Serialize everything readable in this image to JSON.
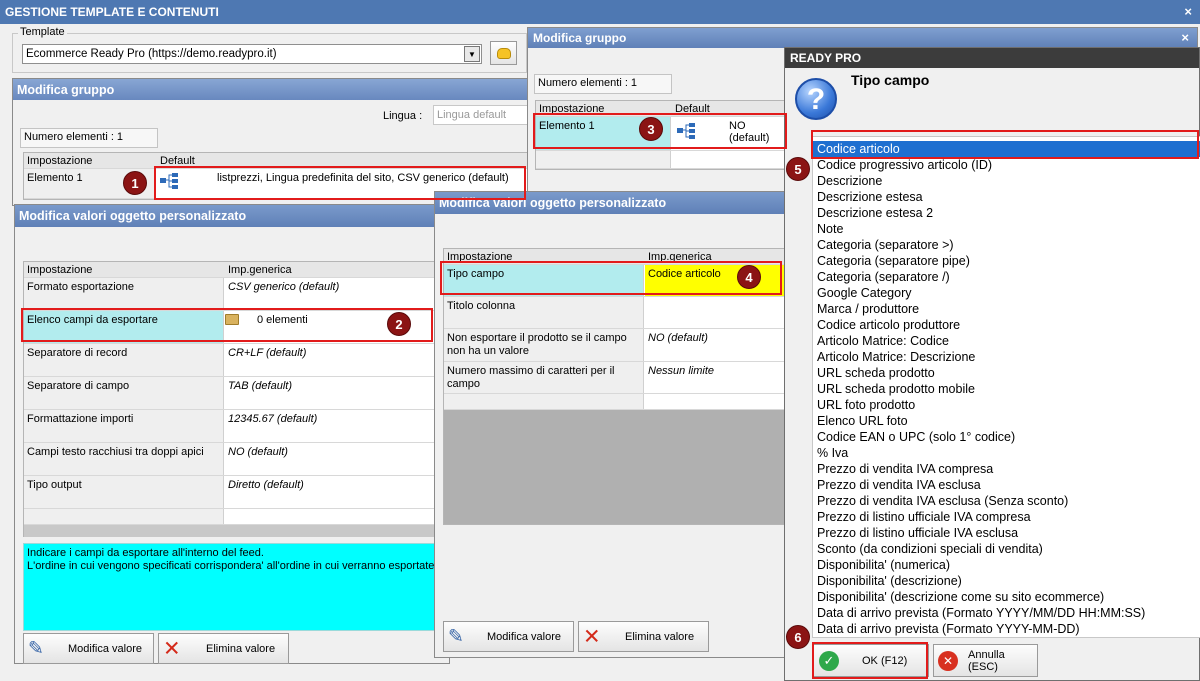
{
  "main": {
    "title": "GESTIONE TEMPLATE E CONTENUTI",
    "close": "×",
    "template_legend": "Template",
    "template_value": "Ecommerce Ready Pro (https://demo.readypro.it)"
  },
  "group1": {
    "title": "Modifica gruppo",
    "lingua_label": "Lingua :",
    "lingua_placeholder": "Lingua default",
    "num_elementi": "Numero elementi : 1",
    "col_impostazione": "Impostazione",
    "col_default": "Default",
    "row_label": "Elemento 1",
    "row_value": "listprezzi, Lingua predefinita del sito, CSV generico (default)"
  },
  "custom1": {
    "title": "Modifica valori oggetto personalizzato",
    "col_impostazione": "Impostazione",
    "col_generica": "Imp.generica",
    "rows": [
      {
        "label": "Formato esportazione",
        "value": "CSV generico (default)"
      },
      {
        "label": "Elenco campi da esportare",
        "value": "0 elementi"
      },
      {
        "label": "Separatore di record",
        "value": "CR+LF (default)"
      },
      {
        "label": "Separatore di campo",
        "value": "TAB (default)"
      },
      {
        "label": "Formattazione importi",
        "value": "12345.67 (default)"
      },
      {
        "label": "Campi testo racchiusi tra doppi apici",
        "value": "NO (default)"
      },
      {
        "label": "Tipo output",
        "value": "Diretto (default)"
      }
    ],
    "help_line1": "Indicare i campi da esportare all'interno del feed.",
    "help_line2": "L'ordine in cui vengono specificati corrispondera' all'ordine in cui verranno esportate le",
    "btn_modifica": "Modifica valore",
    "btn_elimina": "Elimina valore"
  },
  "group2": {
    "title": "Modifica gruppo",
    "close": "×",
    "num_elementi": "Numero elementi : 1",
    "col_impostazione": "Impostazione",
    "col_default": "Default",
    "row_label": "Elemento 1",
    "row_value": "NO (default)"
  },
  "custom2": {
    "title": "Modifica valori oggetto personalizzato",
    "col_impostazione": "Impostazione",
    "col_generica": "Imp.generica",
    "rows": [
      {
        "label": "Tipo campo",
        "value": "Codice articolo"
      },
      {
        "label": "Titolo colonna",
        "value": ""
      },
      {
        "label": "Non esportare il prodotto se il campo non ha un valore",
        "value": "NO (default)"
      },
      {
        "label": "Numero massimo di caratteri per il campo",
        "value": "Nessun limite"
      }
    ],
    "btn_modifica": "Modifica valore",
    "btn_elimina": "Elimina valore"
  },
  "readypro": {
    "title": "READY PRO",
    "heading": "Tipo campo",
    "options": [
      "Codice articolo",
      "Codice progressivo articolo (ID)",
      "Descrizione",
      "Descrizione estesa",
      "Descrizione estesa 2",
      "Note",
      "Categoria (separatore >)",
      "Categoria (separatore pipe)",
      "Categoria (separatore /)",
      "Google Category",
      "Marca / produttore",
      "Codice articolo produttore",
      "Articolo Matrice: Codice",
      "Articolo Matrice: Descrizione",
      "URL scheda prodotto",
      "URL scheda prodotto mobile",
      "URL foto prodotto",
      "Elenco URL foto",
      "Codice EAN o UPC (solo 1° codice)",
      "% Iva",
      "Prezzo di vendita IVA compresa",
      "Prezzo di vendita IVA esclusa",
      "Prezzo di vendita IVA esclusa (Senza sconto)",
      "Prezzo di listino ufficiale IVA compresa",
      "Prezzo di listino ufficiale IVA esclusa",
      "Sconto (da condizioni speciali di vendita)",
      "Disponibilita' (numerica)",
      "Disponibilita' (descrizione)",
      "Disponibilita' (descrizione come su sito ecommerce)",
      "Data di arrivo prevista (Formato YYYY/MM/DD HH:MM:SS)",
      "Data di arrivo prevista (Formato YYYY-MM-DD)"
    ],
    "btn_ok": "OK (F12)",
    "btn_annulla": "Annulla (ESC)"
  },
  "badges": [
    "1",
    "2",
    "3",
    "4",
    "5",
    "6"
  ]
}
